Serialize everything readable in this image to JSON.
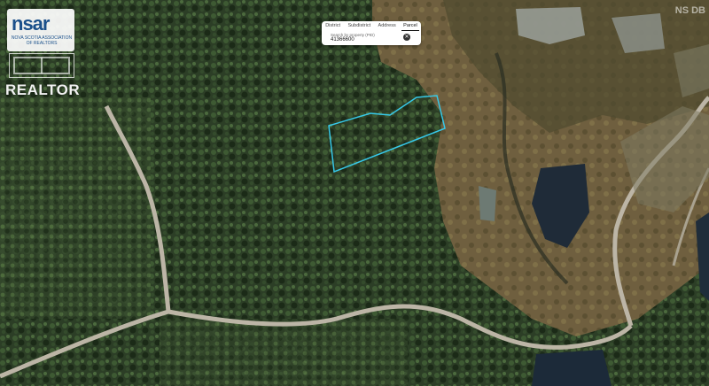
{
  "logo": {
    "wordmark": "nsar",
    "subtext": "NOVA SCOTIA ASSOCIATION OF REALTORS",
    "realtor": "REALTOR"
  },
  "corner_mark": "NS DB",
  "parcel_search": {
    "tabs": [
      "District",
      "Subdistrict",
      "Address",
      "Parcel"
    ],
    "active_tab": "Parcel",
    "search_label": "Search by property (PID)",
    "search_value": "41366600",
    "close_icon": "close-icon"
  },
  "colors": {
    "parcel_outline": "#36c8e8",
    "road": "#b9b2a4",
    "forest": "#25361f",
    "marsh": "#7a6a45",
    "water": "#1d2a37"
  }
}
